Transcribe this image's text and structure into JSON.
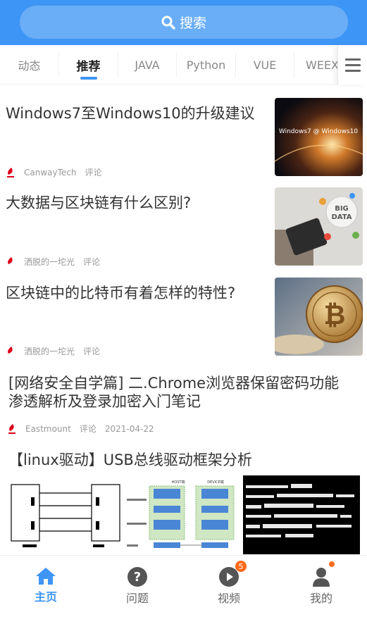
{
  "search": {
    "label": "搜索",
    "icon": "search-icon"
  },
  "tabs": [
    {
      "label": "动态",
      "active": false
    },
    {
      "label": "推荐",
      "active": true
    },
    {
      "label": "JAVA",
      "active": false
    },
    {
      "label": "Python",
      "active": false
    },
    {
      "label": "VUE",
      "active": false
    },
    {
      "label": "WEEX",
      "active": false
    }
  ],
  "colors": {
    "accent": "#3d95f5",
    "badge": "#ff6a1a",
    "author_logo": "#e0001b"
  },
  "articles": [
    {
      "title": "Windows7至Windows10的升级建议",
      "author": "CanwayTech",
      "comment": "评论",
      "thumb_text": "Windows7 @ Windows10"
    },
    {
      "title": "大数据与区块链有什么区别?",
      "author": "洒脱的一坨光",
      "comment": "评论",
      "thumb_text": "BIG DATA"
    },
    {
      "title": "区块链中的比特币有着怎样的特性?",
      "author": "洒脱的一坨光",
      "comment": "评论"
    },
    {
      "title_line1": "[网络安全自学篇] 二.Chrome浏览器保留密码功能",
      "title_line2": "渗透解析及登录加密入门笔记",
      "author": "Eastmount",
      "comment": "评论",
      "date": "2021-04-22"
    },
    {
      "title": "【linux驱动】USB总线驱动框架分析",
      "diagram_labels": [
        "HOST端",
        "DEVICE端"
      ]
    }
  ],
  "bottom_nav": [
    {
      "label": "主页",
      "icon": "home-icon",
      "active": true
    },
    {
      "label": "问题",
      "icon": "question-icon",
      "active": false
    },
    {
      "label": "视频",
      "icon": "play-icon",
      "active": false,
      "badge": "5"
    },
    {
      "label": "我的",
      "icon": "user-icon",
      "active": false,
      "dot": true
    }
  ]
}
